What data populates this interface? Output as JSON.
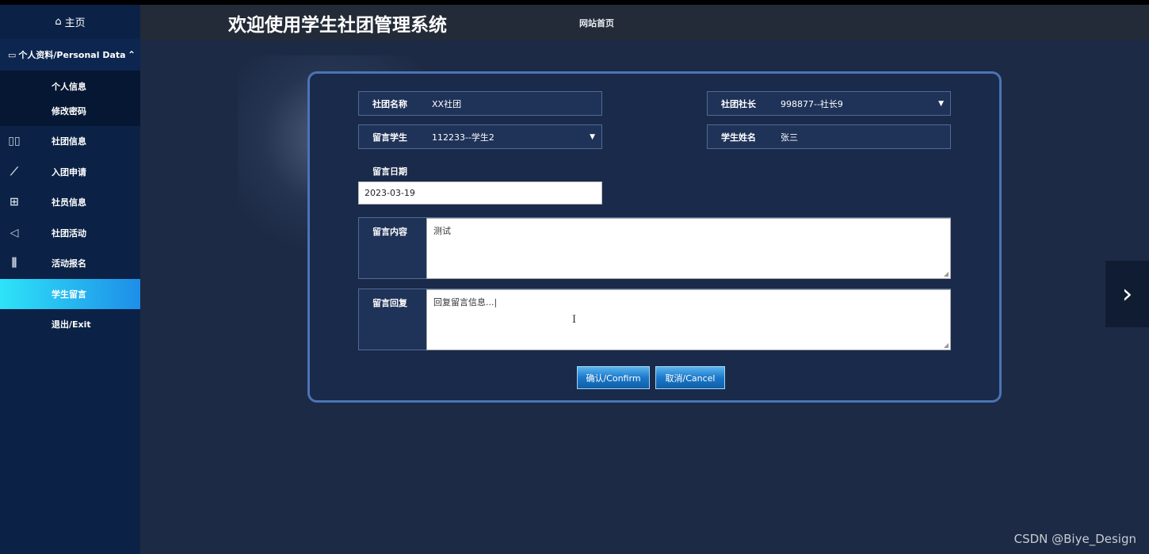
{
  "app": {
    "title": "欢迎使用学生社团管理系统",
    "header_link": "网站首页"
  },
  "sidebar": {
    "home_label": "主页",
    "section_label": "个人资料/Personal Data",
    "sub_items": [
      "个人信息",
      "修改密码"
    ],
    "items": [
      {
        "label": "社团信息",
        "icon": "book-icon"
      },
      {
        "label": "入团申请",
        "icon": "ruler-icon"
      },
      {
        "label": "社员信息",
        "icon": "grid-search-icon"
      },
      {
        "label": "社团活动",
        "icon": "paper-plane-icon"
      },
      {
        "label": "活动报名",
        "icon": "library-icon"
      },
      {
        "label": "学生留言",
        "icon": "",
        "active": true
      },
      {
        "label": "退出/Exit",
        "icon": ""
      }
    ]
  },
  "form": {
    "club_name_label": "社团名称",
    "club_name_value": "XX社团",
    "leader_label": "社团社长",
    "leader_value": "998877--社长9",
    "student_label": "留言学生",
    "student_value": "112233--学生2",
    "student_name_label": "学生姓名",
    "student_name_value": "张三",
    "date_label": "留言日期",
    "date_value": "2023-03-19",
    "content_label": "留言内容",
    "content_value": "测试",
    "reply_label": "留言回复",
    "reply_value": "回复留言信息...|",
    "confirm_label": "确认/Confirm",
    "cancel_label": "取消/Cancel"
  },
  "watermark": "CSDN @Biye_Design"
}
